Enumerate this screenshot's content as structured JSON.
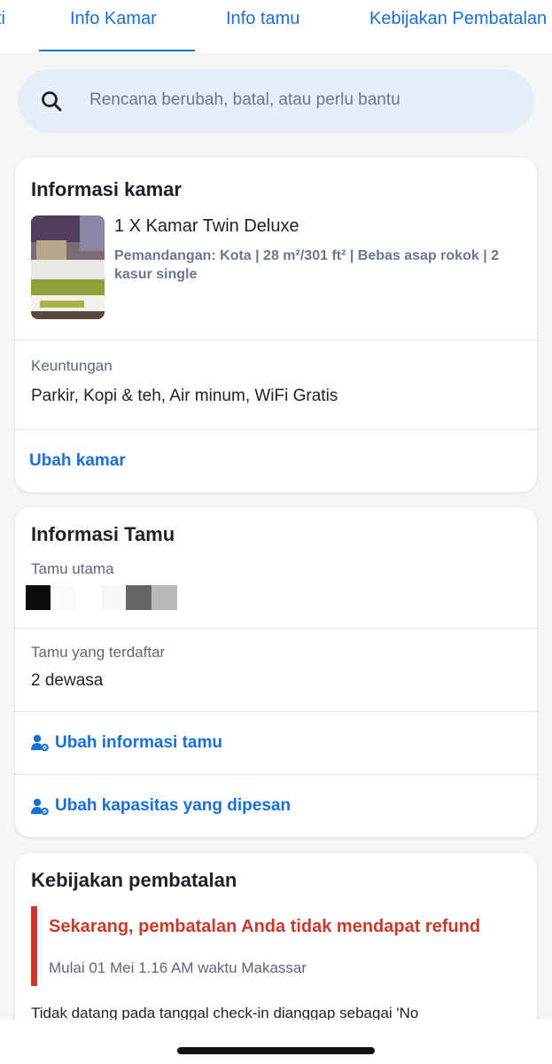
{
  "tabs": [
    {
      "label": "ti"
    },
    {
      "label": "Info Kamar",
      "active": true
    },
    {
      "label": "Info tamu"
    },
    {
      "label": "Kebijakan Pembatalan"
    }
  ],
  "search": {
    "placeholder": "Rencana berubah, batal, atau perlu bantu",
    "icon": "search-icon"
  },
  "room_info": {
    "title": "Informasi kamar",
    "room_name": "1 X Kamar Twin Deluxe",
    "room_desc": "Pemandangan: Kota | 28 m²/301 ft² | Bebas asap rokok | 2 kasur single",
    "benefits_label": "Keuntungan",
    "benefits": "Parkir, Kopi & teh, Air minum, WiFi Gratis",
    "change_room_label": "Ubah kamar"
  },
  "guest_info": {
    "title": "Informasi Tamu",
    "main_guest_label": "Tamu utama",
    "registered_label": "Tamu yang terdaftar",
    "registered_value": "2 dewasa",
    "edit_guest_label": "Ubah informasi tamu",
    "edit_capacity_label": "Ubah kapasitas yang dipesan"
  },
  "cancellation": {
    "title": "Kebijakan pembatalan",
    "warning": "Sekarang, pembatalan Anda tidak mendapat refund",
    "since": "Mulai 01 Mei 1.16 AM waktu Makassar",
    "note": "Tidak datang pada tanggal check-in dianggap sebagai 'No"
  },
  "colors": {
    "accent": "#1a6fd6",
    "danger": "#c83a2a",
    "muted": "#6c7689"
  }
}
